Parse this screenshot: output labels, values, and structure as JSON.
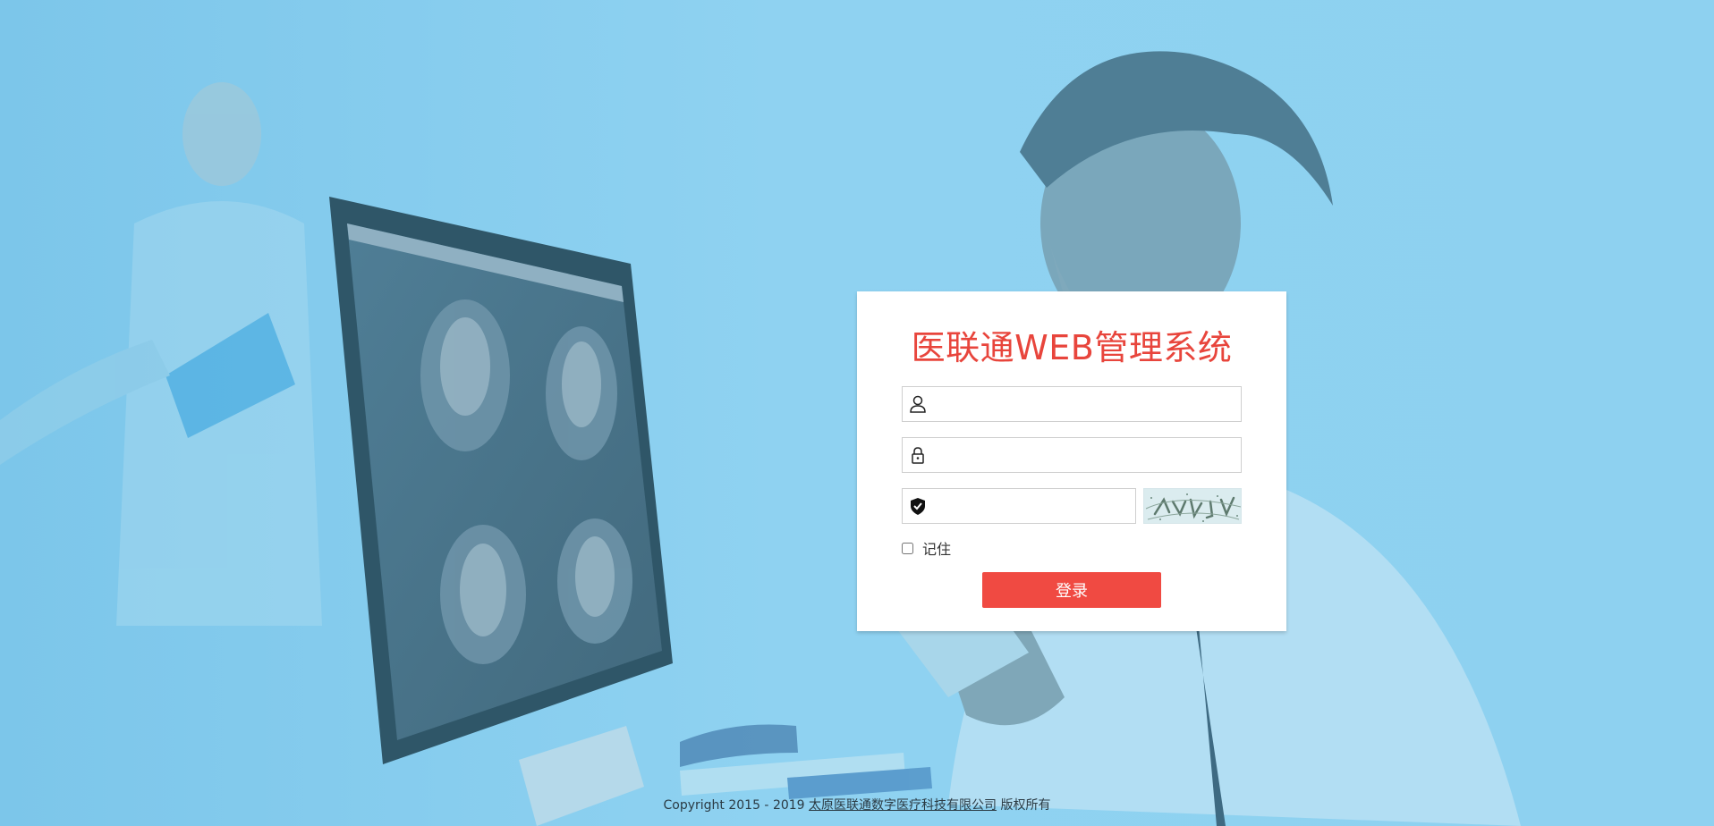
{
  "login": {
    "title": "医联通WEB管理系统",
    "username": {
      "value": "",
      "placeholder": ""
    },
    "password": {
      "value": "",
      "placeholder": ""
    },
    "captcha": {
      "value": "",
      "placeholder": ""
    },
    "remember_label": "记住",
    "remember_checked": false,
    "submit_label": "登录"
  },
  "footer": {
    "copyright_prefix": "Copyright 2015 - 2019",
    "company_link": "太原医联通数字医疗科技有限公司",
    "suffix": "版权所有"
  },
  "colors": {
    "background": "#89cdef",
    "title": "#e8453c",
    "button": "#f04a42"
  },
  "icons": {
    "user": "user-icon",
    "password": "lock-icon",
    "captcha": "shield-check-icon"
  }
}
